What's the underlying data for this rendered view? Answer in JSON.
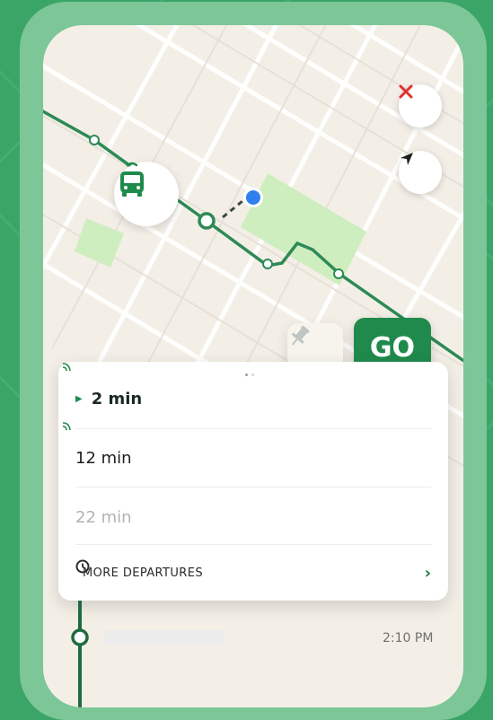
{
  "action_buttons": {
    "go_label": "GO"
  },
  "departures": [
    {
      "time": "2 min",
      "state": "next",
      "live": true
    },
    {
      "time": "12 min",
      "state": "upcoming",
      "live": true
    },
    {
      "time": "22 min",
      "state": "scheduled",
      "live": false
    }
  ],
  "more_departures": {
    "label": "MORE DEPARTURES"
  },
  "route_stop": {
    "time": "2:10 PM"
  },
  "icons": {
    "close": "close-icon",
    "locate": "navigation-arrow-icon",
    "bus": "bus-icon",
    "pin": "pin-icon",
    "clock": "clock-icon",
    "chevron": "chevron-right-icon",
    "realtime": "realtime-signal-icon"
  },
  "colors": {
    "brand_green": "#1f8a4c",
    "route_line": "#2d8a55",
    "background": "#3aa566",
    "close_red": "#e03131",
    "user_dot": "#2f80ed",
    "park": "#cfeec0"
  }
}
